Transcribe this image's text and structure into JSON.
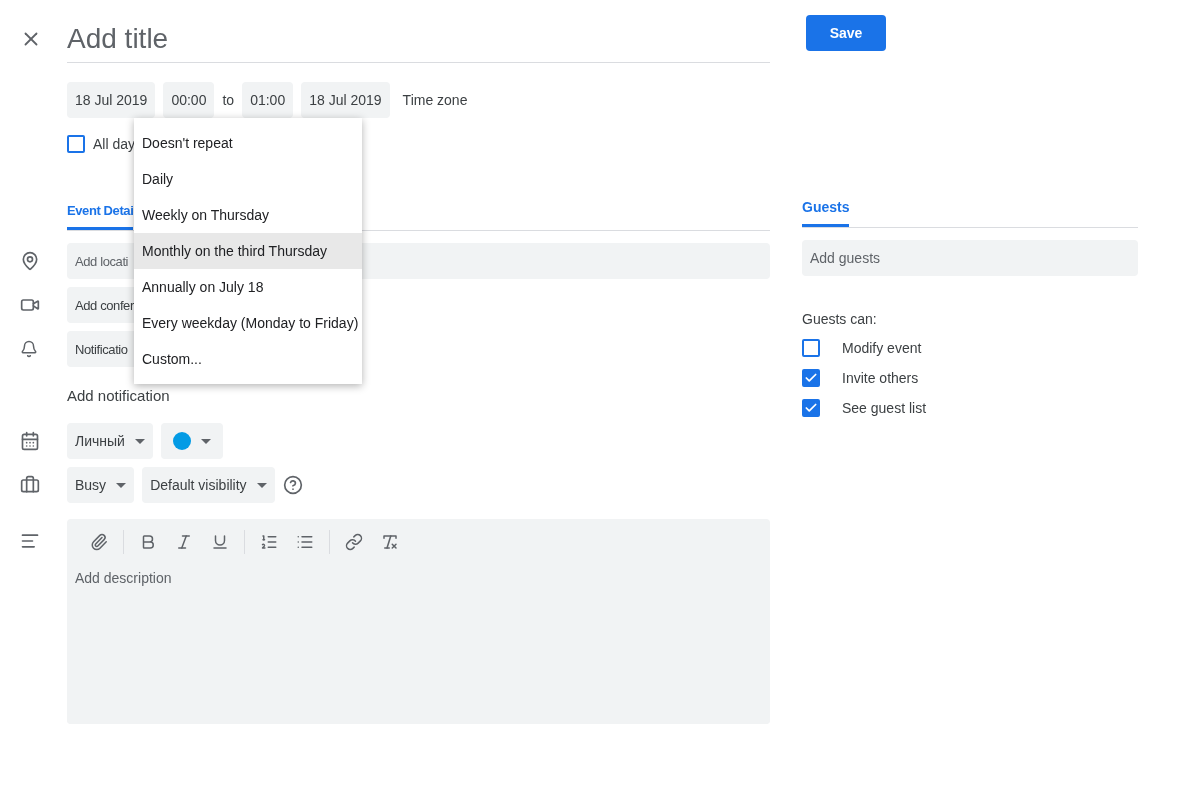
{
  "title": {
    "placeholder": "Add title"
  },
  "save_button": "Save",
  "date_row": {
    "start_date": "18 Jul 2019",
    "start_time": "00:00",
    "separator": "to",
    "end_time": "01:00",
    "end_date": "18 Jul 2019",
    "time_zone": "Time zone"
  },
  "all_day": {
    "label": "All day",
    "checked": false
  },
  "repeat_menu": {
    "items": [
      {
        "label": "Doesn't repeat",
        "highlighted": false
      },
      {
        "label": "Daily",
        "highlighted": false
      },
      {
        "label": "Weekly on Thursday",
        "highlighted": false
      },
      {
        "label": "Monthly on the third Thursday",
        "highlighted": true
      },
      {
        "label": "Annually on July 18",
        "highlighted": false
      },
      {
        "label": "Every weekday (Monday to Friday)",
        "highlighted": false
      },
      {
        "label": "Custom...",
        "highlighted": false
      }
    ]
  },
  "details_tab": {
    "label": "Event Detai",
    "selected": true
  },
  "details": {
    "location": {
      "placeholder": "Add locati"
    },
    "conference": "Add confer",
    "notification": "Notificatio",
    "add_notification": "Add notification",
    "calendar": "Личный",
    "event_color": {
      "color": "#039be5"
    },
    "availability": "Busy",
    "visibility": "Default visibility",
    "description": {
      "placeholder": "Add description"
    }
  },
  "guests_tab": {
    "label": "Guests",
    "selected": true
  },
  "guests": {
    "field": {
      "placeholder": "Add guests"
    },
    "permissions_title": "Guests can:",
    "permissions": [
      {
        "label": "Modify event",
        "checked": false
      },
      {
        "label": "Invite others",
        "checked": true
      },
      {
        "label": "See guest list",
        "checked": true
      }
    ]
  }
}
